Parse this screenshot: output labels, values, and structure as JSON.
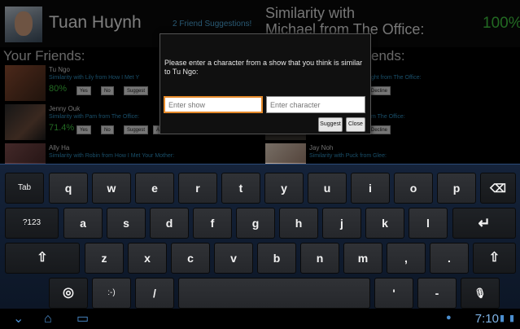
{
  "header": {
    "user_name": "Tuan Huynh",
    "friend_suggestions": "2 Friend Suggestions!",
    "similarity_title": "Similarity with\nMichael from The Office:",
    "similarity_percent": "100%"
  },
  "friends_title": "Your Friends:",
  "right_title": "ends:",
  "friends": [
    {
      "name": "Tu Ngo",
      "similarity": "Similarity with Lily from How I Met Y",
      "percent": "80%",
      "buttons": [
        "Yes",
        "No",
        "Suggest"
      ],
      "photo": "#6b3b2b"
    },
    {
      "name": "Jenny Ouk",
      "similarity": "Similarity with Pam from The Office:",
      "percent": "71.4%",
      "buttons": [
        "Yes",
        "No",
        "Suggest",
        "Add Friend"
      ],
      "photo": "#3a2a22"
    },
    {
      "name": "Ally Ha",
      "similarity": "Similarity with Robin from How I Met Your Mother:",
      "percent": "",
      "buttons": [],
      "photo": "#5a3a3a"
    }
  ],
  "right_list": [
    {
      "name": "",
      "similarity": "ght from The Office:",
      "buttons": [
        "Decline"
      ]
    },
    {
      "name": "",
      "similarity": "m The Office:",
      "buttons": [
        "Decline"
      ]
    },
    {
      "name": "Jay Noh",
      "similarity": "Similarity with Puck from Glee:",
      "buttons": []
    }
  ],
  "dialog": {
    "message": "Please enter a character from a show that you think is similar to Tu Ngo:",
    "show_placeholder": "Enter show",
    "character_placeholder": "Enter character",
    "suggest_label": "Suggest",
    "close_label": "Close"
  },
  "keyboard": {
    "row1": [
      "Tab",
      "q",
      "w",
      "e",
      "r",
      "t",
      "y",
      "u",
      "i",
      "o",
      "p",
      "⌫"
    ],
    "row2": [
      "?123",
      "a",
      "s",
      "d",
      "f",
      "g",
      "h",
      "j",
      "k",
      "l",
      "↵"
    ],
    "row3": [
      "⇧",
      "z",
      "x",
      "c",
      "v",
      "b",
      "n",
      "m",
      ",",
      ".",
      "⇧"
    ],
    "row4": [
      "◎",
      ":-)",
      "/",
      "",
      "'",
      "-",
      "🎙"
    ]
  },
  "system_bar": {
    "clock": "7:10",
    "icons": [
      "back-icon",
      "home-icon",
      "recent-apps-icon",
      "signal-icon",
      "battery-icon"
    ]
  },
  "colors": {
    "accent_blue": "#4aa0cf",
    "percent_green": "#3fbf3f",
    "focus_orange": "#e58a2b",
    "keyboard_bg": "#15233a"
  }
}
